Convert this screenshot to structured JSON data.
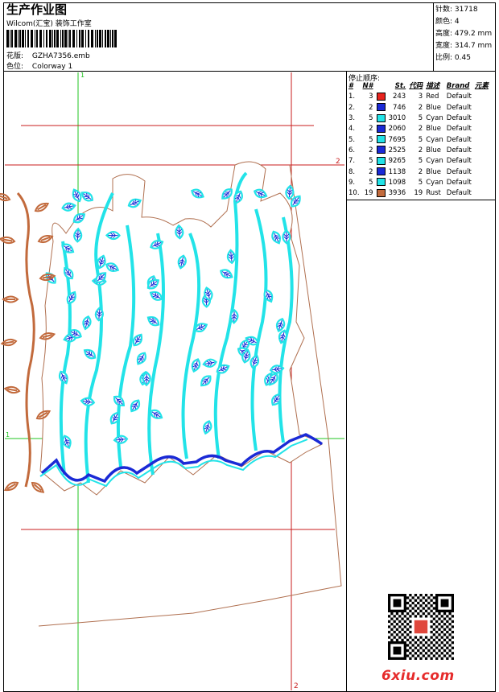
{
  "header": {
    "title": "生产作业图",
    "vendor": "Wilcom(汇宝) 装饰工作室",
    "design_label": "花版:",
    "design_value": "GZHA7356.emb",
    "colorway_label": "色位:",
    "colorway_value": "Colorway 1"
  },
  "stats": [
    {
      "label": "针数:",
      "value": "31718"
    },
    {
      "label": "颜色:",
      "value": "4"
    },
    {
      "label": "高度:",
      "value": "479.2 mm"
    },
    {
      "label": "宽度:",
      "value": "314.7 mm"
    },
    {
      "label": "比例:",
      "value": "0.45"
    }
  ],
  "stops": {
    "heading": "停止顺序:",
    "columns": [
      "#",
      "N#",
      "St.",
      "代码",
      "描述",
      "Brand",
      "元素"
    ],
    "rows": [
      {
        "idx": "1.",
        "n": "3",
        "color": "#e8231e",
        "st": "243",
        "code": "3",
        "desc": "Red",
        "brand": "Default"
      },
      {
        "idx": "2.",
        "n": "2",
        "color": "#1a2ad6",
        "st": "746",
        "code": "2",
        "desc": "Blue",
        "brand": "Default"
      },
      {
        "idx": "3.",
        "n": "5",
        "color": "#22e3e8",
        "st": "3010",
        "code": "5",
        "desc": "Cyan",
        "brand": "Default"
      },
      {
        "idx": "4.",
        "n": "2",
        "color": "#1a2ad6",
        "st": "2060",
        "code": "2",
        "desc": "Blue",
        "brand": "Default"
      },
      {
        "idx": "5.",
        "n": "5",
        "color": "#22e3e8",
        "st": "7695",
        "code": "5",
        "desc": "Cyan",
        "brand": "Default"
      },
      {
        "idx": "6.",
        "n": "2",
        "color": "#1a2ad6",
        "st": "2525",
        "code": "2",
        "desc": "Blue",
        "brand": "Default"
      },
      {
        "idx": "7.",
        "n": "5",
        "color": "#22e3e8",
        "st": "9265",
        "code": "5",
        "desc": "Cyan",
        "brand": "Default"
      },
      {
        "idx": "8.",
        "n": "2",
        "color": "#1a2ad6",
        "st": "1138",
        "code": "2",
        "desc": "Blue",
        "brand": "Default"
      },
      {
        "idx": "9.",
        "n": "5",
        "color": "#22e3e8",
        "st": "1098",
        "code": "5",
        "desc": "Cyan",
        "brand": "Default"
      },
      {
        "idx": "10.",
        "n": "19",
        "color": "#c26a3c",
        "st": "3936",
        "code": "19",
        "desc": "Rust",
        "brand": "Default"
      }
    ]
  },
  "guides": {
    "v1": "1",
    "h1": "1",
    "v2": "2",
    "h2": "2"
  },
  "colors": {
    "cyan": "#22e3e8",
    "blue": "#1a2ad6",
    "rust": "#c26a3c",
    "guide_green": "#22c422",
    "guide_red": "#c81e1e",
    "outline": "#b07050"
  },
  "watermark": {
    "site": "6xiu.com"
  }
}
